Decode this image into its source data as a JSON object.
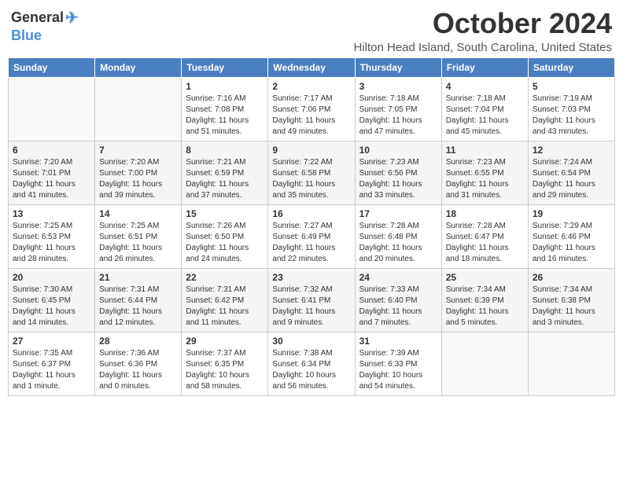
{
  "header": {
    "logo_general": "General",
    "logo_blue": "Blue",
    "month_title": "October 2024",
    "location": "Hilton Head Island, South Carolina, United States"
  },
  "weekdays": [
    "Sunday",
    "Monday",
    "Tuesday",
    "Wednesday",
    "Thursday",
    "Friday",
    "Saturday"
  ],
  "weeks": [
    [
      {
        "day": "",
        "info": ""
      },
      {
        "day": "",
        "info": ""
      },
      {
        "day": "1",
        "info": "Sunrise: 7:16 AM\nSunset: 7:08 PM\nDaylight: 11 hours and 51 minutes."
      },
      {
        "day": "2",
        "info": "Sunrise: 7:17 AM\nSunset: 7:06 PM\nDaylight: 11 hours and 49 minutes."
      },
      {
        "day": "3",
        "info": "Sunrise: 7:18 AM\nSunset: 7:05 PM\nDaylight: 11 hours and 47 minutes."
      },
      {
        "day": "4",
        "info": "Sunrise: 7:18 AM\nSunset: 7:04 PM\nDaylight: 11 hours and 45 minutes."
      },
      {
        "day": "5",
        "info": "Sunrise: 7:19 AM\nSunset: 7:03 PM\nDaylight: 11 hours and 43 minutes."
      }
    ],
    [
      {
        "day": "6",
        "info": "Sunrise: 7:20 AM\nSunset: 7:01 PM\nDaylight: 11 hours and 41 minutes."
      },
      {
        "day": "7",
        "info": "Sunrise: 7:20 AM\nSunset: 7:00 PM\nDaylight: 11 hours and 39 minutes."
      },
      {
        "day": "8",
        "info": "Sunrise: 7:21 AM\nSunset: 6:59 PM\nDaylight: 11 hours and 37 minutes."
      },
      {
        "day": "9",
        "info": "Sunrise: 7:22 AM\nSunset: 6:58 PM\nDaylight: 11 hours and 35 minutes."
      },
      {
        "day": "10",
        "info": "Sunrise: 7:23 AM\nSunset: 6:56 PM\nDaylight: 11 hours and 33 minutes."
      },
      {
        "day": "11",
        "info": "Sunrise: 7:23 AM\nSunset: 6:55 PM\nDaylight: 11 hours and 31 minutes."
      },
      {
        "day": "12",
        "info": "Sunrise: 7:24 AM\nSunset: 6:54 PM\nDaylight: 11 hours and 29 minutes."
      }
    ],
    [
      {
        "day": "13",
        "info": "Sunrise: 7:25 AM\nSunset: 6:53 PM\nDaylight: 11 hours and 28 minutes."
      },
      {
        "day": "14",
        "info": "Sunrise: 7:25 AM\nSunset: 6:51 PM\nDaylight: 11 hours and 26 minutes."
      },
      {
        "day": "15",
        "info": "Sunrise: 7:26 AM\nSunset: 6:50 PM\nDaylight: 11 hours and 24 minutes."
      },
      {
        "day": "16",
        "info": "Sunrise: 7:27 AM\nSunset: 6:49 PM\nDaylight: 11 hours and 22 minutes."
      },
      {
        "day": "17",
        "info": "Sunrise: 7:28 AM\nSunset: 6:48 PM\nDaylight: 11 hours and 20 minutes."
      },
      {
        "day": "18",
        "info": "Sunrise: 7:28 AM\nSunset: 6:47 PM\nDaylight: 11 hours and 18 minutes."
      },
      {
        "day": "19",
        "info": "Sunrise: 7:29 AM\nSunset: 6:46 PM\nDaylight: 11 hours and 16 minutes."
      }
    ],
    [
      {
        "day": "20",
        "info": "Sunrise: 7:30 AM\nSunset: 6:45 PM\nDaylight: 11 hours and 14 minutes."
      },
      {
        "day": "21",
        "info": "Sunrise: 7:31 AM\nSunset: 6:44 PM\nDaylight: 11 hours and 12 minutes."
      },
      {
        "day": "22",
        "info": "Sunrise: 7:31 AM\nSunset: 6:42 PM\nDaylight: 11 hours and 11 minutes."
      },
      {
        "day": "23",
        "info": "Sunrise: 7:32 AM\nSunset: 6:41 PM\nDaylight: 11 hours and 9 minutes."
      },
      {
        "day": "24",
        "info": "Sunrise: 7:33 AM\nSunset: 6:40 PM\nDaylight: 11 hours and 7 minutes."
      },
      {
        "day": "25",
        "info": "Sunrise: 7:34 AM\nSunset: 6:39 PM\nDaylight: 11 hours and 5 minutes."
      },
      {
        "day": "26",
        "info": "Sunrise: 7:34 AM\nSunset: 6:38 PM\nDaylight: 11 hours and 3 minutes."
      }
    ],
    [
      {
        "day": "27",
        "info": "Sunrise: 7:35 AM\nSunset: 6:37 PM\nDaylight: 11 hours and 1 minute."
      },
      {
        "day": "28",
        "info": "Sunrise: 7:36 AM\nSunset: 6:36 PM\nDaylight: 11 hours and 0 minutes."
      },
      {
        "day": "29",
        "info": "Sunrise: 7:37 AM\nSunset: 6:35 PM\nDaylight: 10 hours and 58 minutes."
      },
      {
        "day": "30",
        "info": "Sunrise: 7:38 AM\nSunset: 6:34 PM\nDaylight: 10 hours and 56 minutes."
      },
      {
        "day": "31",
        "info": "Sunrise: 7:39 AM\nSunset: 6:33 PM\nDaylight: 10 hours and 54 minutes."
      },
      {
        "day": "",
        "info": ""
      },
      {
        "day": "",
        "info": ""
      }
    ]
  ]
}
